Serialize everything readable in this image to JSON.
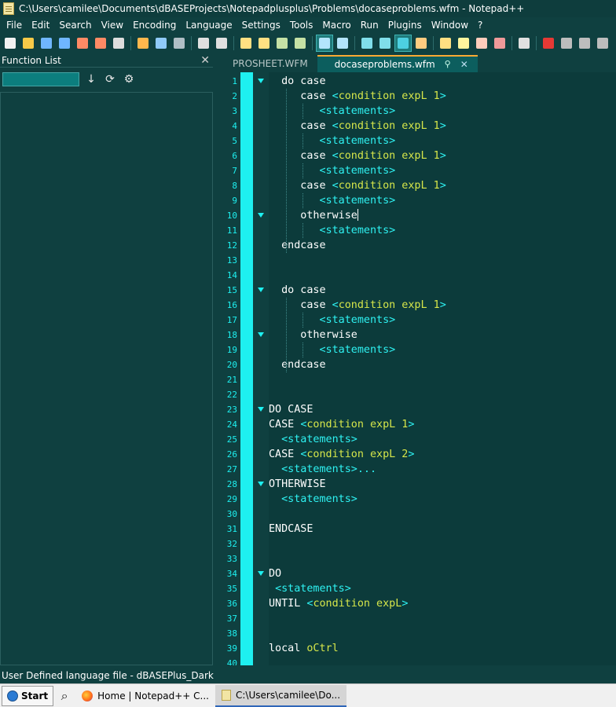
{
  "window": {
    "title": "C:\\Users\\camilee\\Documents\\dBASEProjects\\Notepadplusplus\\Problems\\docaseproblems.wfm - Notepad++"
  },
  "menu": [
    "File",
    "Edit",
    "Search",
    "View",
    "Encoding",
    "Language",
    "Settings",
    "Tools",
    "Macro",
    "Run",
    "Plugins",
    "Window",
    "?"
  ],
  "toolbar": {
    "icons": [
      "new-file-icon",
      "open-file-icon",
      "save-icon",
      "save-all-icon",
      "close-icon",
      "close-all-icon",
      "print-icon",
      "cut-icon",
      "copy-icon",
      "paste-icon",
      "undo-icon",
      "redo-icon",
      "find-icon",
      "replace-icon",
      "zoom-in-icon",
      "zoom-out-icon",
      "sync-vertical-icon",
      "sync-horizontal-icon",
      "word-wrap-icon",
      "show-all-chars-icon",
      "indent-guide-icon",
      "language-icon",
      "folder-as-workspace-icon",
      "function-list-icon",
      "doc-map-icon",
      "doc-list-icon",
      "monitoring-icon",
      "record-macro-icon",
      "stop-macro-icon",
      "play-macro-icon",
      "run-macro-multiple-icon"
    ]
  },
  "function_list": {
    "title": "Function List",
    "close_glyph": "✕",
    "sort_glyph": "↓",
    "refresh_glyph": "⟳",
    "settings_glyph": "⚙"
  },
  "tabs": [
    {
      "label": "PROSHEET.WFM",
      "active": false
    },
    {
      "label": "docaseproblems.wfm",
      "active": true
    }
  ],
  "tab_pin_glyph": "⚲",
  "tab_close_glyph": "✕",
  "editor": {
    "lines": [
      {
        "n": "1",
        "fold": true,
        "tokens": [
          [
            "kw",
            "  do case"
          ]
        ]
      },
      {
        "n": "2",
        "fold": false,
        "tokens": [
          [
            "kw",
            "     case "
          ],
          [
            "op",
            "<"
          ],
          [
            "arg",
            "condition expL 1"
          ],
          [
            "op",
            ">"
          ]
        ]
      },
      {
        "n": "3",
        "fold": false,
        "tokens": [
          [
            "kw",
            "        "
          ],
          [
            "op",
            "<statements>"
          ]
        ]
      },
      {
        "n": "4",
        "fold": false,
        "tokens": [
          [
            "kw",
            "     case "
          ],
          [
            "op",
            "<"
          ],
          [
            "arg",
            "condition expL 1"
          ],
          [
            "op",
            ">"
          ]
        ]
      },
      {
        "n": "5",
        "fold": false,
        "tokens": [
          [
            "kw",
            "        "
          ],
          [
            "op",
            "<statements>"
          ]
        ]
      },
      {
        "n": "6",
        "fold": false,
        "tokens": [
          [
            "kw",
            "     case "
          ],
          [
            "op",
            "<"
          ],
          [
            "arg",
            "condition expL 1"
          ],
          [
            "op",
            ">"
          ]
        ]
      },
      {
        "n": "7",
        "fold": false,
        "tokens": [
          [
            "kw",
            "        "
          ],
          [
            "op",
            "<statements>"
          ]
        ]
      },
      {
        "n": "8",
        "fold": false,
        "tokens": [
          [
            "kw",
            "     case "
          ],
          [
            "op",
            "<"
          ],
          [
            "arg",
            "condition expL 1"
          ],
          [
            "op",
            ">"
          ]
        ]
      },
      {
        "n": "9",
        "fold": false,
        "tokens": [
          [
            "kw",
            "        "
          ],
          [
            "op",
            "<statements>"
          ]
        ]
      },
      {
        "n": "10",
        "fold": true,
        "tokens": [
          [
            "kw",
            "     otherwise"
          ]
        ],
        "caret": true
      },
      {
        "n": "11",
        "fold": false,
        "tokens": [
          [
            "kw",
            "        "
          ],
          [
            "op",
            "<statements>"
          ]
        ]
      },
      {
        "n": "12",
        "fold": false,
        "tokens": [
          [
            "kw",
            "  endcase"
          ]
        ]
      },
      {
        "n": "13",
        "fold": false,
        "tokens": []
      },
      {
        "n": "14",
        "fold": false,
        "tokens": []
      },
      {
        "n": "15",
        "fold": true,
        "tokens": [
          [
            "kw",
            "  do case"
          ]
        ]
      },
      {
        "n": "16",
        "fold": false,
        "tokens": [
          [
            "kw",
            "     case "
          ],
          [
            "op",
            "<"
          ],
          [
            "arg",
            "condition expL 1"
          ],
          [
            "op",
            ">"
          ]
        ]
      },
      {
        "n": "17",
        "fold": false,
        "tokens": [
          [
            "kw",
            "        "
          ],
          [
            "op",
            "<statements>"
          ]
        ]
      },
      {
        "n": "18",
        "fold": true,
        "tokens": [
          [
            "kw",
            "     otherwise"
          ]
        ]
      },
      {
        "n": "19",
        "fold": false,
        "tokens": [
          [
            "kw",
            "        "
          ],
          [
            "op",
            "<statements>"
          ]
        ]
      },
      {
        "n": "20",
        "fold": false,
        "tokens": [
          [
            "kw",
            "  endcase"
          ]
        ]
      },
      {
        "n": "21",
        "fold": false,
        "tokens": []
      },
      {
        "n": "22",
        "fold": false,
        "tokens": []
      },
      {
        "n": "23",
        "fold": true,
        "tokens": [
          [
            "kw",
            "DO CASE"
          ]
        ]
      },
      {
        "n": "24",
        "fold": false,
        "tokens": [
          [
            "kw",
            "CASE "
          ],
          [
            "op",
            "<"
          ],
          [
            "arg",
            "condition expL 1"
          ],
          [
            "op",
            ">"
          ]
        ]
      },
      {
        "n": "25",
        "fold": false,
        "tokens": [
          [
            "kw",
            "  "
          ],
          [
            "op",
            "<statements>"
          ]
        ]
      },
      {
        "n": "26",
        "fold": false,
        "tokens": [
          [
            "kw",
            "CASE "
          ],
          [
            "op",
            "<"
          ],
          [
            "arg",
            "condition expL 2"
          ],
          [
            "op",
            ">"
          ]
        ]
      },
      {
        "n": "27",
        "fold": false,
        "tokens": [
          [
            "kw",
            "  "
          ],
          [
            "op",
            "<statements>..."
          ]
        ]
      },
      {
        "n": "28",
        "fold": true,
        "tokens": [
          [
            "kw",
            "OTHERWISE"
          ]
        ]
      },
      {
        "n": "29",
        "fold": false,
        "tokens": [
          [
            "kw",
            "  "
          ],
          [
            "op",
            "<statements>"
          ]
        ]
      },
      {
        "n": "30",
        "fold": false,
        "tokens": []
      },
      {
        "n": "31",
        "fold": false,
        "tokens": [
          [
            "kw",
            "ENDCASE"
          ]
        ]
      },
      {
        "n": "32",
        "fold": false,
        "tokens": []
      },
      {
        "n": "33",
        "fold": false,
        "tokens": []
      },
      {
        "n": "34",
        "fold": true,
        "tokens": [
          [
            "kw",
            "DO"
          ]
        ]
      },
      {
        "n": "35",
        "fold": false,
        "tokens": [
          [
            "kw",
            " "
          ],
          [
            "op",
            "<statements>"
          ]
        ]
      },
      {
        "n": "36",
        "fold": false,
        "tokens": [
          [
            "kw",
            "UNTIL "
          ],
          [
            "op",
            "<"
          ],
          [
            "arg",
            "condition expL"
          ],
          [
            "op",
            ">"
          ]
        ]
      },
      {
        "n": "37",
        "fold": false,
        "tokens": []
      },
      {
        "n": "38",
        "fold": false,
        "tokens": []
      },
      {
        "n": "39",
        "fold": false,
        "tokens": [
          [
            "kw",
            "local "
          ],
          [
            "arg",
            "oCtrl"
          ]
        ]
      },
      {
        "n": "40",
        "fold": false,
        "tokens": []
      }
    ]
  },
  "status": {
    "language": "User Defined language file - dBASEPlus_Dark"
  },
  "taskbar": {
    "start_label": "Start",
    "tasks": [
      {
        "label": "Home | Notepad++ C...",
        "icon": "firefox-icon",
        "active": false
      },
      {
        "label": "C:\\Users\\camilee\\Do...",
        "icon": "notepadpp-icon",
        "active": true
      }
    ]
  },
  "colors": {
    "background": "#0c3b3b",
    "keyword": "#ffffff",
    "operator": "#2ef2f2",
    "argument": "#d6e64a",
    "line_number": "#1ef0f0",
    "margin_bar": "#1ef0f0",
    "tab_accent": "#ffaa33"
  }
}
